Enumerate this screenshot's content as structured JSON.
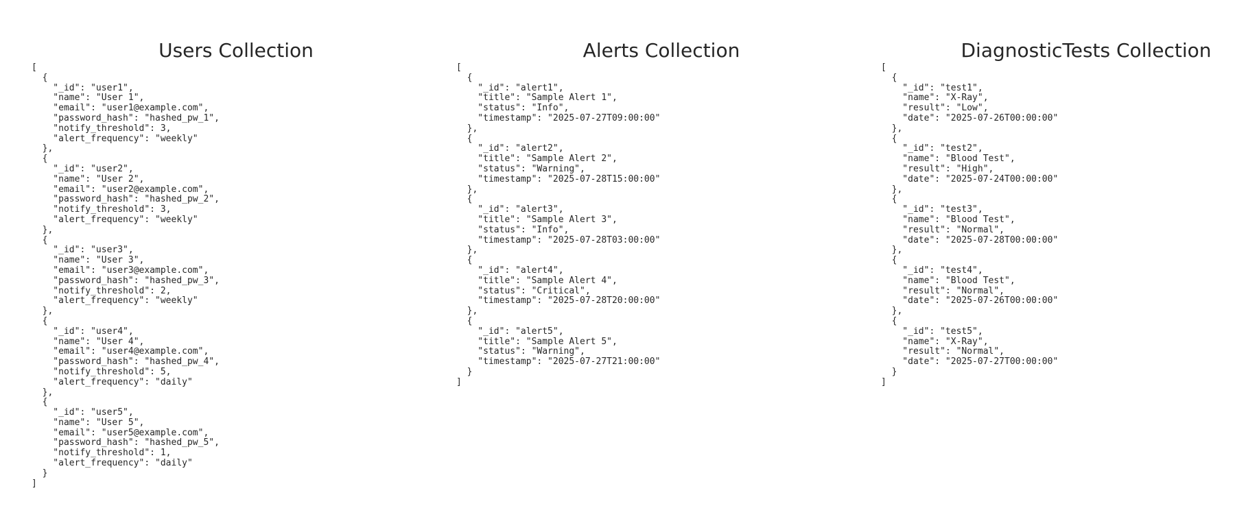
{
  "panels": [
    {
      "title": "Users Collection",
      "documents": [
        {
          "_id": "user1",
          "name": "User 1",
          "email": "user1@example.com",
          "password_hash": "hashed_pw_1",
          "notify_threshold": 3,
          "alert_frequency": "weekly"
        },
        {
          "_id": "user2",
          "name": "User 2",
          "email": "user2@example.com",
          "password_hash": "hashed_pw_2",
          "notify_threshold": 3,
          "alert_frequency": "weekly"
        },
        {
          "_id": "user3",
          "name": "User 3",
          "email": "user3@example.com",
          "password_hash": "hashed_pw_3",
          "notify_threshold": 2,
          "alert_frequency": "weekly"
        },
        {
          "_id": "user4",
          "name": "User 4",
          "email": "user4@example.com",
          "password_hash": "hashed_pw_4",
          "notify_threshold": 5,
          "alert_frequency": "daily"
        },
        {
          "_id": "user5",
          "name": "User 5",
          "email": "user5@example.com",
          "password_hash": "hashed_pw_5",
          "notify_threshold": 1,
          "alert_frequency": "daily"
        }
      ]
    },
    {
      "title": "Alerts Collection",
      "documents": [
        {
          "_id": "alert1",
          "title": "Sample Alert 1",
          "status": "Info",
          "timestamp": "2025-07-27T09:00:00"
        },
        {
          "_id": "alert2",
          "title": "Sample Alert 2",
          "status": "Warning",
          "timestamp": "2025-07-28T15:00:00"
        },
        {
          "_id": "alert3",
          "title": "Sample Alert 3",
          "status": "Info",
          "timestamp": "2025-07-28T03:00:00"
        },
        {
          "_id": "alert4",
          "title": "Sample Alert 4",
          "status": "Critical",
          "timestamp": "2025-07-28T20:00:00"
        },
        {
          "_id": "alert5",
          "title": "Sample Alert 5",
          "status": "Warning",
          "timestamp": "2025-07-27T21:00:00"
        }
      ]
    },
    {
      "title": "DiagnosticTests Collection",
      "documents": [
        {
          "_id": "test1",
          "name": "X-Ray",
          "result": "Low",
          "date": "2025-07-26T00:00:00"
        },
        {
          "_id": "test2",
          "name": "Blood Test",
          "result": "High",
          "date": "2025-07-24T00:00:00"
        },
        {
          "_id": "test3",
          "name": "Blood Test",
          "result": "Normal",
          "date": "2025-07-28T00:00:00"
        },
        {
          "_id": "test4",
          "name": "Blood Test",
          "result": "Normal",
          "date": "2025-07-26T00:00:00"
        },
        {
          "_id": "test5",
          "name": "X-Ray",
          "result": "Normal",
          "date": "2025-07-27T00:00:00"
        }
      ]
    }
  ]
}
